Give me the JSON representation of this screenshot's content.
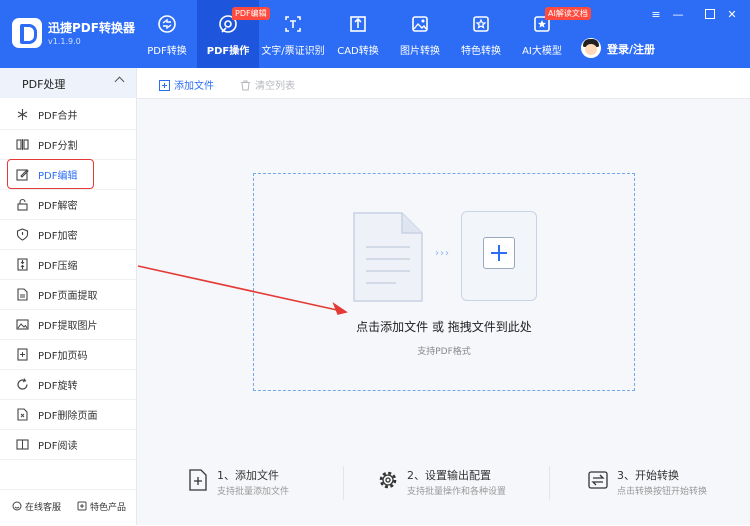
{
  "app": {
    "name": "迅捷PDF转换器",
    "version": "v1.1.9.0",
    "brand_color": "#2d6df5"
  },
  "nav": {
    "tabs": [
      {
        "label": "PDF转换",
        "icon": "pdf-convert-icon"
      },
      {
        "label": "PDF操作",
        "icon": "pdf-operate-icon",
        "active": true,
        "badge": "PDF编辑"
      },
      {
        "label": "文字/票证识别",
        "icon": "text-recognition-icon"
      },
      {
        "label": "CAD转换",
        "icon": "cad-icon"
      },
      {
        "label": "图片转换",
        "icon": "image-icon"
      },
      {
        "label": "特色转换",
        "icon": "star-icon"
      },
      {
        "label": "AI大模型",
        "icon": "ai-icon",
        "badge": "AI解读文档"
      }
    ]
  },
  "user": {
    "login_label": "登录/注册"
  },
  "window_controls": [
    "menu",
    "minimize",
    "maximize",
    "close"
  ],
  "sidebar": {
    "header": "PDF处理",
    "items": [
      {
        "label": "PDF合并"
      },
      {
        "label": "PDF分割"
      },
      {
        "label": "PDF编辑",
        "active": true
      },
      {
        "label": "PDF解密"
      },
      {
        "label": "PDF加密"
      },
      {
        "label": "PDF压缩"
      },
      {
        "label": "PDF页面提取"
      },
      {
        "label": "PDF提取图片"
      },
      {
        "label": "PDF加页码"
      },
      {
        "label": "PDF旋转"
      },
      {
        "label": "PDF删除页面"
      },
      {
        "label": "PDF阅读"
      }
    ],
    "footer": {
      "service": "在线客服",
      "products": "特色产品"
    }
  },
  "toolbar": {
    "add_file": "添加文件",
    "clear_list": "清空列表"
  },
  "dropzone": {
    "main_text": "点击添加文件 或 拖拽文件到此处",
    "sub_text": "支持PDF格式"
  },
  "steps": [
    {
      "title": "1、添加文件",
      "subtitle": "支持批量添加文件"
    },
    {
      "title": "2、设置输出配置",
      "subtitle": "支持批量操作和各种设置"
    },
    {
      "title": "3、开始转换",
      "subtitle": "点击转换按钮开始转换"
    }
  ]
}
